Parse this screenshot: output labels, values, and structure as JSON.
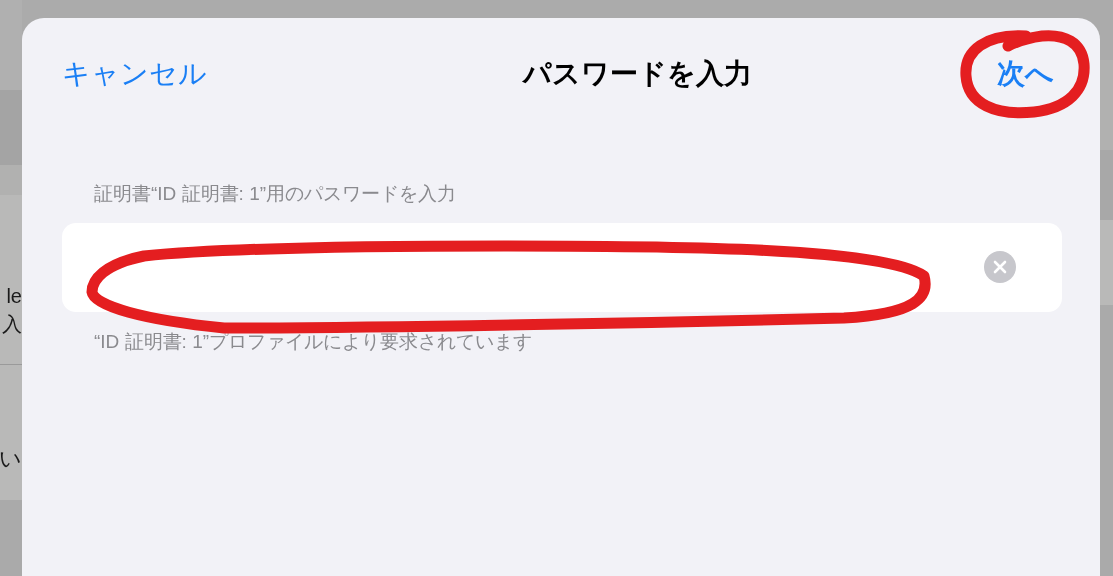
{
  "background": {
    "fragments": [
      {
        "text": "le"
      },
      {
        "text": "入"
      },
      {
        "text": "い"
      }
    ]
  },
  "sheet": {
    "cancel": "キャンセル",
    "title": "パスワードを入力",
    "next": "次へ",
    "field_label": "証明書“ID 証明書: 1”用のパスワードを入力",
    "footer": "“ID 証明書: 1”プロファイルにより要求されています"
  },
  "annotations": [
    {
      "kind": "loop"
    },
    {
      "kind": "loop"
    }
  ]
}
